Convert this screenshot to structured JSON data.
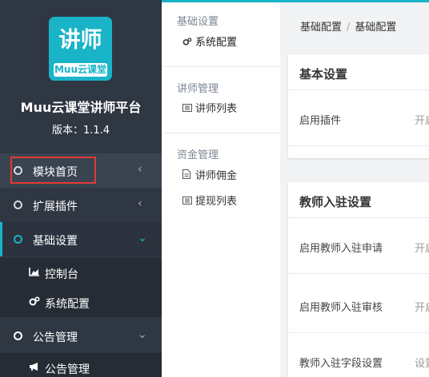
{
  "brand": {
    "logo_main": "讲师",
    "logo_sub": "Muu云课堂",
    "title": "Muu云课堂讲师平台",
    "version": "版本：1.1.4"
  },
  "sidebar": {
    "items": [
      {
        "label": "模块首页"
      },
      {
        "label": "扩展插件"
      },
      {
        "label": "基础设置"
      },
      {
        "label": "公告管理"
      }
    ],
    "basic_subitems": [
      {
        "label": "控制台"
      },
      {
        "label": "系统配置"
      }
    ],
    "notice_subitems": [
      {
        "label": "公告管理"
      }
    ]
  },
  "submenu": {
    "groups": [
      {
        "title": "基础设置",
        "links": [
          {
            "label": "系统配置"
          }
        ]
      },
      {
        "title": "讲师管理",
        "links": [
          {
            "label": "讲师列表"
          }
        ]
      },
      {
        "title": "资金管理",
        "links": [
          {
            "label": "讲师佣金"
          },
          {
            "label": "提现列表"
          }
        ]
      }
    ]
  },
  "breadcrumb": [
    "基础配置",
    "基础配置"
  ],
  "cards": [
    {
      "title": "基本设置",
      "rows": [
        {
          "label": "启用插件",
          "value": "开启"
        }
      ]
    },
    {
      "title": "教师入驻设置",
      "rows": [
        {
          "label": "启用教师入驻申请",
          "value": "开启"
        },
        {
          "label": "启用教师入驻审核",
          "value": "开启"
        },
        {
          "label": "教师入驻字段设置",
          "value": "设置"
        }
      ]
    }
  ],
  "colors": {
    "accent": "#19b4c7",
    "sidebar_bg": "#2f3743",
    "highlight": "#e53935"
  }
}
